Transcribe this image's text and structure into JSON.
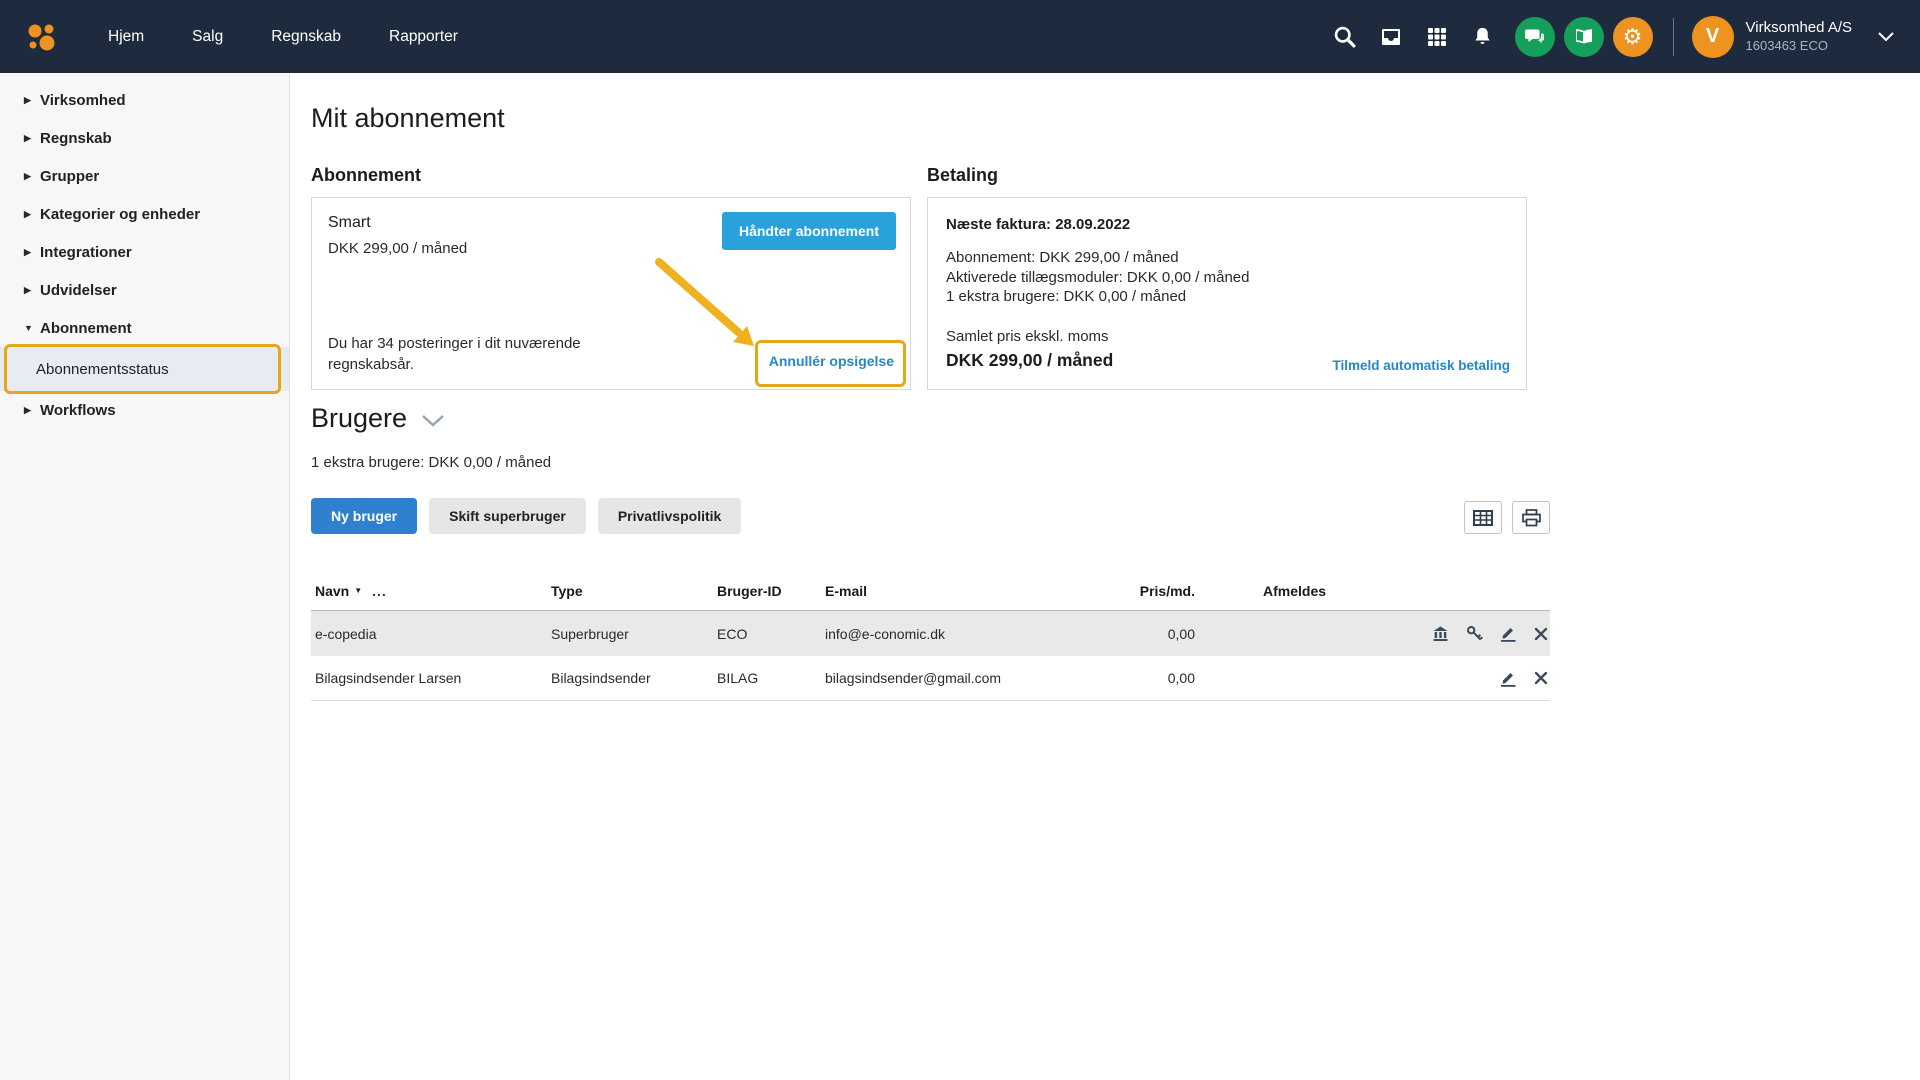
{
  "topbar": {
    "nav": [
      "Hjem",
      "Salg",
      "Regnskab",
      "Rapporter"
    ],
    "company_name": "Virksomhed A/S",
    "company_id": "1603463 ECO",
    "avatar_letter": "V"
  },
  "sidebar": {
    "items": [
      {
        "label": "Virksomhed"
      },
      {
        "label": "Regnskab"
      },
      {
        "label": "Grupper"
      },
      {
        "label": "Kategorier og enheder"
      },
      {
        "label": "Integrationer"
      },
      {
        "label": "Udvidelser"
      },
      {
        "label": "Abonnement"
      },
      {
        "label": "Abonnementsstatus"
      },
      {
        "label": "Workflows"
      }
    ]
  },
  "page": {
    "title": "Mit abonnement",
    "subscription": {
      "heading": "Abonnement",
      "plan_name": "Smart",
      "plan_price": "DKK 299,00 / måned",
      "manage_button": "Håndter abonnement",
      "postings_note": "Du har 34 posteringer i dit nuværende regnskabsår.",
      "cancel_link": "Annullér opsigelse"
    },
    "payment": {
      "heading": "Betaling",
      "next_invoice": "Næste faktura: 28.09.2022",
      "line_subscription": "Abonnement: DKK 299,00 / måned",
      "line_modules": "Aktiverede tillægsmoduler: DKK 0,00 / måned",
      "line_extra_users": "1 ekstra brugere: DKK 0,00 / måned",
      "total_label": "Samlet pris ekskl. moms",
      "total_value": "DKK 299,00 / måned",
      "autopay_link": "Tilmeld automatisk betaling"
    },
    "users": {
      "heading": "Brugere",
      "subtitle": "1 ekstra brugere: DKK 0,00 / måned",
      "new_user_button": "Ny bruger",
      "change_superuser_button": "Skift superbruger",
      "privacy_button": "Privatlivspolitik",
      "table": {
        "headers": {
          "name": "Navn",
          "type": "Type",
          "user_id": "Bruger-ID",
          "email": "E-mail",
          "price": "Pris/md.",
          "unsubscribe": "Afmeldes",
          "overflow": "..."
        },
        "rows": [
          {
            "name": "e-copedia",
            "type": "Superbruger",
            "user_id": "ECO",
            "email": "info@e-conomic.dk",
            "price": "0,00"
          },
          {
            "name": "Bilagsindsender Larsen",
            "type": "Bilagsindsender",
            "user_id": "BILAG",
            "email": "bilagsindsender@gmail.com",
            "price": "0,00"
          }
        ]
      }
    }
  },
  "colors": {
    "topbar_bg": "#1e2a3d",
    "primary_blue": "#2f80cf",
    "sky_blue": "#29a1da",
    "link_blue": "#2388cc",
    "green": "#14a05a",
    "orange": "#ef9320",
    "annotation_yellow": "#e4a71b",
    "selected_row_bg": "#e9e9e9"
  },
  "icons": [
    "search-icon",
    "inbox-icon",
    "apps-grid-icon",
    "bell-icon",
    "chat-icon",
    "book-icon",
    "gear-icon",
    "chevron-down-icon",
    "caret-right-icon",
    "caret-down-icon",
    "table-view-icon",
    "print-icon",
    "building-icon",
    "key-icon",
    "edit-icon",
    "delete-icon"
  ]
}
